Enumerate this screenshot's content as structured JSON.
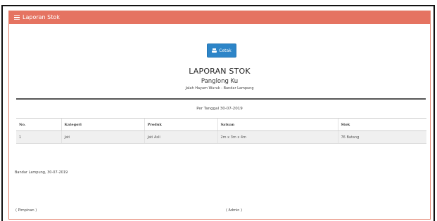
{
  "panel": {
    "title": "Laporan Stok"
  },
  "actions": {
    "cetak_label": "Cetak"
  },
  "report": {
    "title": "LAPORAN STOK",
    "company": "Panglong Ku",
    "address": "Jalah Hayam Wuruk - Bandar Lampung",
    "date_line": "Per Tanggal 30-07-2019"
  },
  "table": {
    "headers": [
      "No.",
      "Kategori",
      "Produk",
      "Satuan",
      "Stok"
    ],
    "rows": [
      [
        "1",
        "Jati",
        "Jati Asli",
        "2m x 3m x 4m",
        "76 Batang"
      ]
    ]
  },
  "footer": {
    "place_date": "Bandar Lampung, 30-07-2019",
    "signature_left": "( Pimpinan )",
    "signature_right": "( Admin )"
  },
  "colors": {
    "header_bg": "#e57361",
    "button_bg": "#2d85c8"
  }
}
